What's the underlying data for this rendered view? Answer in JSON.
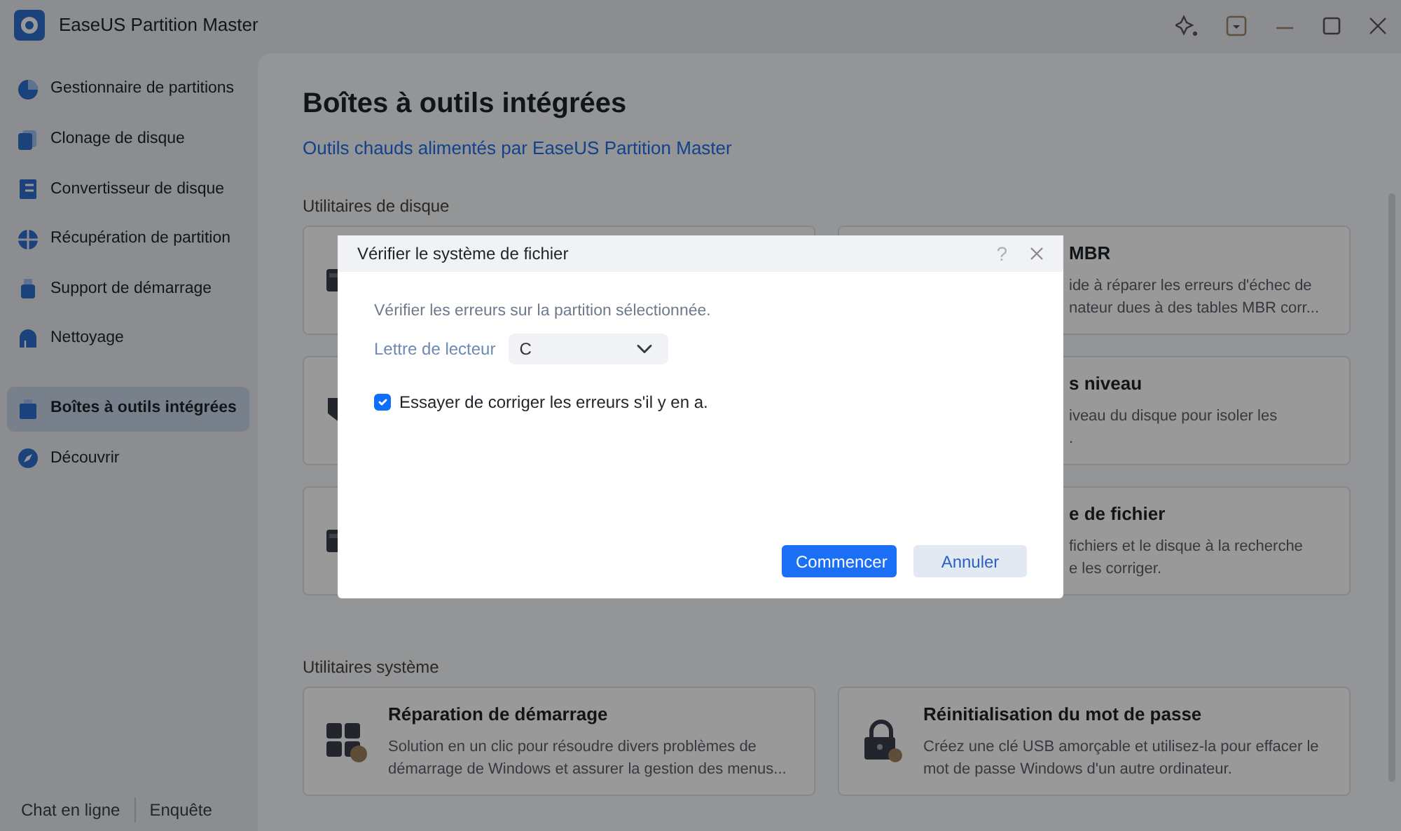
{
  "window": {
    "title": "EaseUS Partition Master"
  },
  "sidebar": {
    "items": [
      {
        "label": "Gestionnaire de partitions",
        "selected": false
      },
      {
        "label": "Clonage de disque",
        "selected": false
      },
      {
        "label": "Convertisseur de disque",
        "selected": false
      },
      {
        "label": "Récupération de partition",
        "selected": false
      },
      {
        "label": "Support de démarrage",
        "selected": false
      },
      {
        "label": "Nettoyage",
        "selected": false
      },
      {
        "label": "Boîtes à outils intégrées",
        "selected": true
      },
      {
        "label": "Découvrir",
        "selected": false
      }
    ],
    "footer_links": [
      "Chat en ligne",
      "Enquête"
    ]
  },
  "main": {
    "title": "Boîtes à outils intégrées",
    "subtitle": "Outils chauds alimentés par EaseUS Partition Master",
    "sections": [
      {
        "heading": "Utilitaires de disque",
        "cards": [
          {
            "kind": "covered"
          },
          {
            "kind": "clipped",
            "title": "MBR",
            "description_lines": [
              "ide à réparer les erreurs d'échec de",
              "nateur dues à des tables MBR corr..."
            ]
          },
          {
            "kind": "covered"
          },
          {
            "kind": "clipped",
            "title": "s niveau",
            "description_lines": [
              "iveau du disque pour isoler les",
              "."
            ]
          },
          {
            "kind": "covered"
          },
          {
            "kind": "clipped",
            "title": "e de fichier",
            "description_lines": [
              "fichiers et le disque à la recherche",
              "e les corriger."
            ]
          }
        ]
      },
      {
        "heading": "Utilitaires système",
        "cards": [
          {
            "kind": "full",
            "title": "Réparation de démarrage",
            "description_lines": [
              "Solution en un clic pour résoudre divers problèmes de",
              "démarrage de Windows et assurer la gestion des menus..."
            ]
          },
          {
            "kind": "full",
            "title": "Réinitialisation du mot de passe",
            "description_lines": [
              "Créez une clé USB amorçable et utilisez-la pour effacer le",
              "mot de passe Windows d'un autre ordinateur."
            ]
          }
        ]
      }
    ]
  },
  "dialog": {
    "title": "Vérifier le système de fichier",
    "help": "?",
    "message": "Vérifier les erreurs sur la partition sélectionnée.",
    "field": {
      "label": "Lettre de lecteur",
      "value": "C"
    },
    "checkbox": {
      "label": "Essayer de corriger les erreurs s'il y en a.",
      "checked": true
    },
    "buttons": [
      {
        "label": "Commencer",
        "kind": "primary"
      },
      {
        "label": "Annuler",
        "kind": "secondary"
      }
    ]
  }
}
